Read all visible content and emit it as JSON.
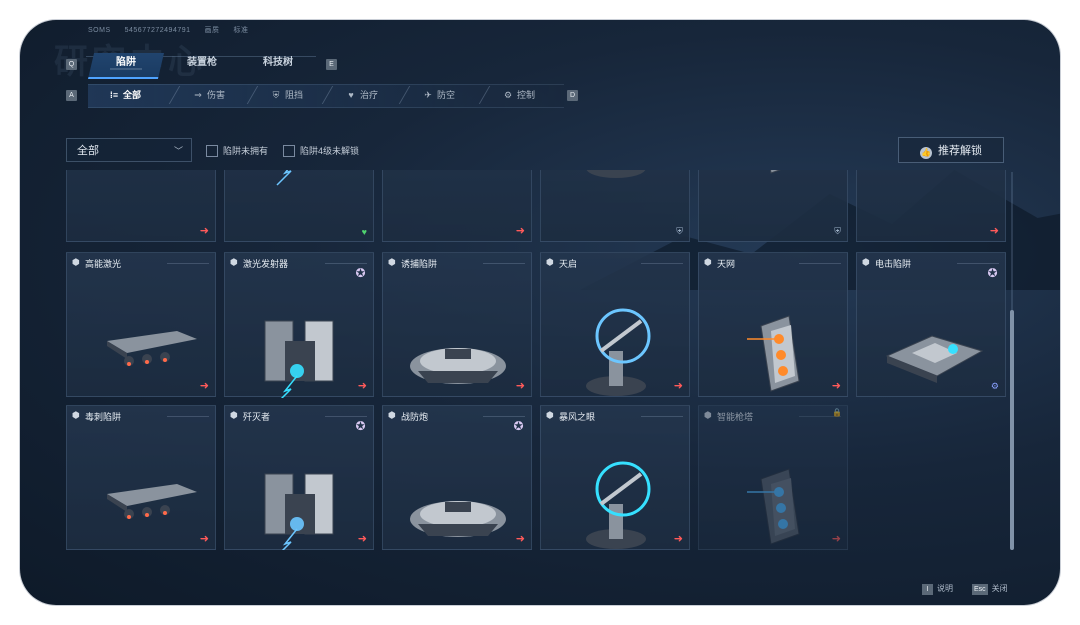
{
  "window": {
    "uid_label": "SOMS",
    "uid_value": "545677272494791",
    "mode_label": "画质",
    "mode_value": "标准"
  },
  "background_title": "研究中心",
  "keys": {
    "prev_tab": "Q",
    "next_tab": "E",
    "prev_filter": "A",
    "next_filter": "D"
  },
  "main_tabs": [
    {
      "label": "陷阱",
      "active": true
    },
    {
      "label": "装置枪",
      "active": false
    },
    {
      "label": "科技树",
      "active": false
    }
  ],
  "role_tabs": [
    {
      "icon": "all-icon",
      "glyph": "⁞≡",
      "label": "全部",
      "active": true
    },
    {
      "icon": "damage-icon",
      "glyph": "⇒",
      "label": "伤害",
      "active": false
    },
    {
      "icon": "block-icon",
      "glyph": "⛨",
      "label": "阻挡",
      "active": false
    },
    {
      "icon": "heal-icon",
      "glyph": "♥",
      "label": "治疗",
      "active": false
    },
    {
      "icon": "anti-air-icon",
      "glyph": "✈",
      "label": "防空",
      "active": false
    },
    {
      "icon": "control-icon",
      "glyph": "⚙",
      "label": "控制",
      "active": false
    }
  ],
  "filters": {
    "dropdown_value": "全部",
    "check_unowned": "陷阱未拥有",
    "check_lv4_locked": "陷阱4级未解锁",
    "recommend_button": "推荐解锁"
  },
  "cards": [
    {
      "name": "",
      "role": "damage",
      "badge": false,
      "locked": false
    },
    {
      "name": "",
      "role": "heal",
      "badge": false,
      "locked": false
    },
    {
      "name": "",
      "role": "damage",
      "badge": false,
      "locked": false
    },
    {
      "name": "",
      "role": "anti-air",
      "badge": false,
      "locked": false
    },
    {
      "name": "",
      "role": "block",
      "badge": false,
      "locked": false
    },
    {
      "name": "",
      "role": "damage",
      "badge": false,
      "locked": false
    },
    {
      "name": "高能激光",
      "role": "damage",
      "badge": false,
      "locked": false
    },
    {
      "name": "激光发射器",
      "role": "damage",
      "badge": true,
      "locked": false
    },
    {
      "name": "诱捕陷阱",
      "role": "damage",
      "badge": false,
      "locked": false
    },
    {
      "name": "天启",
      "role": "damage",
      "badge": false,
      "locked": false
    },
    {
      "name": "天网",
      "role": "damage",
      "badge": false,
      "locked": false
    },
    {
      "name": "电击陷阱",
      "role": "control",
      "badge": true,
      "locked": false
    },
    {
      "name": "毒刺陷阱",
      "role": "damage",
      "badge": false,
      "locked": false
    },
    {
      "name": "歼灭者",
      "role": "damage",
      "badge": true,
      "locked": false
    },
    {
      "name": "战防炮",
      "role": "damage",
      "badge": true,
      "locked": false
    },
    {
      "name": "暴风之眼",
      "role": "damage",
      "badge": false,
      "locked": false
    },
    {
      "name": "智能枪塔",
      "role": "damage",
      "badge": false,
      "locked": true
    }
  ],
  "footer": {
    "help_key": "I",
    "help_label": "说明",
    "close_key": "Esc",
    "close_label": "关闭"
  },
  "colors": {
    "accent": "#4fa3ff",
    "damage": "#ff5a5a",
    "heal": "#4fd36f",
    "control": "#8aa0ff",
    "badge": "#d9c9f2"
  }
}
